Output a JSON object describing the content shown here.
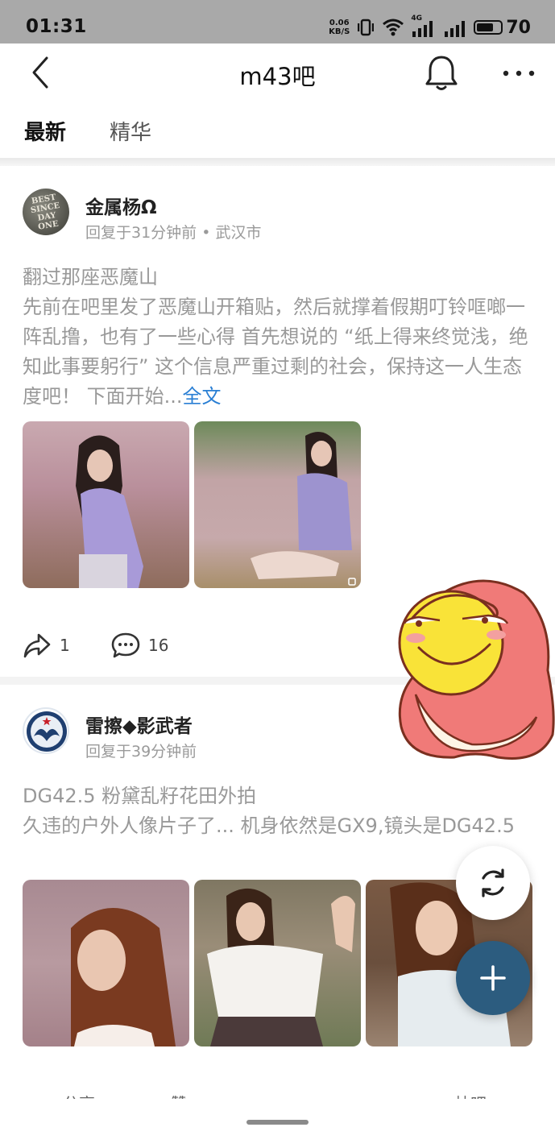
{
  "status_bar": {
    "time": "01:31",
    "net_speed_value": "0.06",
    "net_speed_unit": "KB/S",
    "network_label": "4G",
    "battery": "70",
    "battery_level": 0.7
  },
  "nav": {
    "title": "m43吧"
  },
  "tabs": [
    {
      "label": "最新",
      "active": true
    },
    {
      "label": "精华",
      "active": false
    }
  ],
  "posts": [
    {
      "avatar_text": [
        "BEST",
        "SINCE",
        "DAY",
        "ONE"
      ],
      "username": "金属杨Ω",
      "meta": "回复于31分钟前 • 武汉市",
      "title": "翻过那座恶魔山",
      "body": "先前在吧里发了恶魔山开箱贴，然后就撑着假期叮铃哐啷一阵乱撸，也有了一些心得 首先想说的 “纸上得来终觉浅，绝知此事要躬行” 这个信息严重过剩的社会，保持这一人生态度吧！ 下面开始...",
      "full_text_link": "全文",
      "share_count": "1",
      "comment_count": "16"
    },
    {
      "username": "雷擦◆影武者",
      "meta": "回复于39分钟前",
      "title": "DG42.5 粉黛乱籽花田外拍",
      "body": "久违的户外人像片子了... 机身依然是GX9,镜头是DG42.5",
      "bottom_share": "分享",
      "bottom_like": "赞",
      "bottom_hint": "帖吧"
    }
  ],
  "colors": {
    "status_bar_bg": "#a9a9a9",
    "link_blue": "#2a7fd4",
    "fab_blue": "#2c5c7f"
  }
}
